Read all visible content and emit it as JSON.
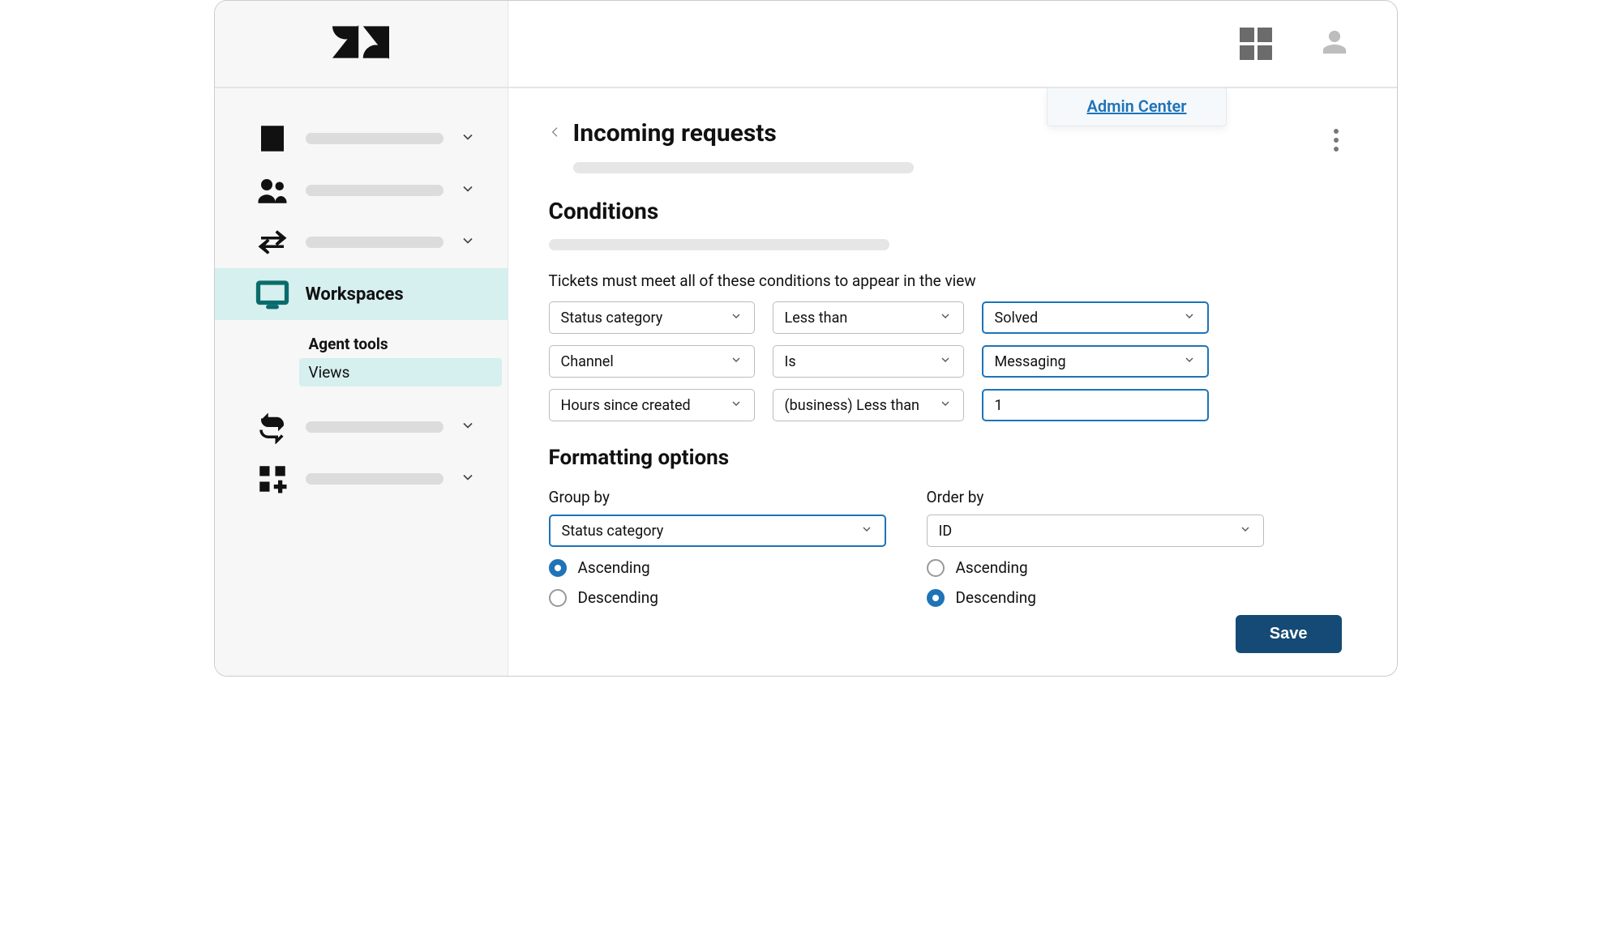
{
  "header": {
    "admin_center_label": "Admin Center"
  },
  "sidebar": {
    "workspaces_label": "Workspaces",
    "agent_tools_label": "Agent tools",
    "views_label": "Views"
  },
  "page": {
    "title": "Incoming requests",
    "conditions_heading": "Conditions",
    "conditions_helper": "Tickets must meet all of these conditions to appear in the view",
    "rows": [
      {
        "field": "Status category",
        "operator": "Less than",
        "value": "Solved"
      },
      {
        "field": "Channel",
        "operator": "Is",
        "value": "Messaging"
      },
      {
        "field": "Hours since created",
        "operator": "(business) Less than",
        "value": "1"
      }
    ],
    "formatting_heading": "Formatting options",
    "group_by_label": "Group by",
    "group_by_value": "Status category",
    "order_by_label": "Order by",
    "order_by_value": "ID",
    "ascending_label": "Ascending",
    "descending_label": "Descending",
    "save_label": "Save"
  }
}
